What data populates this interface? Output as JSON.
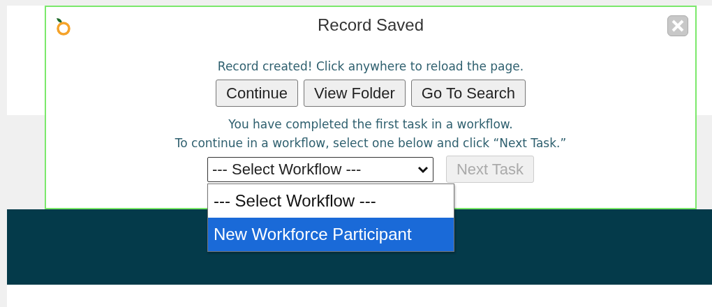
{
  "dialog": {
    "title": "Record Saved",
    "message": "Record created! Click anywhere to reload the page.",
    "buttons": [
      {
        "label": "Continue",
        "disabled": false
      },
      {
        "label": "View Folder",
        "disabled": false
      },
      {
        "label": "Go To Search",
        "disabled": false
      }
    ],
    "workflow_text": [
      "You have completed the first task in a workflow.",
      "To continue in a workflow, select one below and click “Next Task.”"
    ],
    "workflow_select": {
      "value": "--- Select Workflow ---",
      "expanded": true,
      "options": [
        {
          "label": "--- Select Workflow ---",
          "highlighted": false
        },
        {
          "label": "New Workforce Participant",
          "highlighted": true
        }
      ]
    },
    "next_button": {
      "label": "Next Task",
      "disabled": true
    }
  }
}
